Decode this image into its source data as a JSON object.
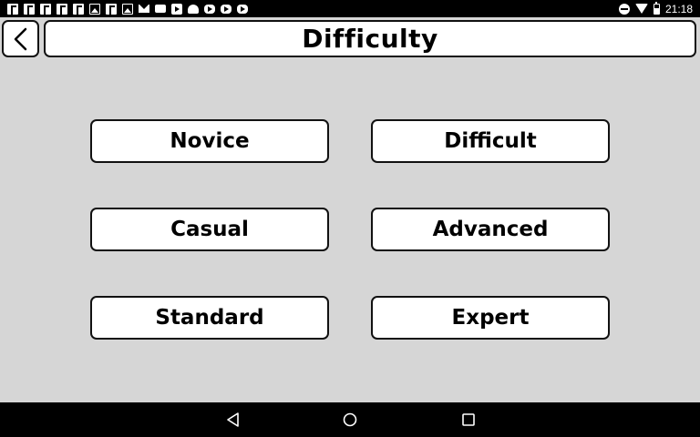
{
  "status_bar": {
    "notification_icons": [
      "facebook-icon",
      "facebook-icon",
      "facebook-icon",
      "facebook-icon",
      "facebook-icon",
      "image-icon",
      "facebook-icon",
      "image-icon",
      "mail-icon",
      "chat-icon",
      "play-store-icon",
      "android-icon",
      "youtube-icon",
      "youtube-icon",
      "youtube-icon"
    ],
    "system_icons": [
      "do-not-disturb-icon",
      "wifi-icon",
      "battery-icon"
    ],
    "time": "21:18"
  },
  "header": {
    "back_icon": "chevron-left-icon",
    "title": "Difficulty"
  },
  "options": [
    {
      "label": "Novice"
    },
    {
      "label": "Difficult"
    },
    {
      "label": "Casual"
    },
    {
      "label": "Advanced"
    },
    {
      "label": "Standard"
    },
    {
      "label": "Expert"
    }
  ],
  "nav_bar": {
    "icons": [
      "back-triangle-icon",
      "home-circle-icon",
      "recents-square-icon"
    ]
  },
  "colors": {
    "background": "#d6d6d6",
    "button_fill": "#ffffff",
    "button_border": "#111111",
    "bars": "#000000"
  }
}
